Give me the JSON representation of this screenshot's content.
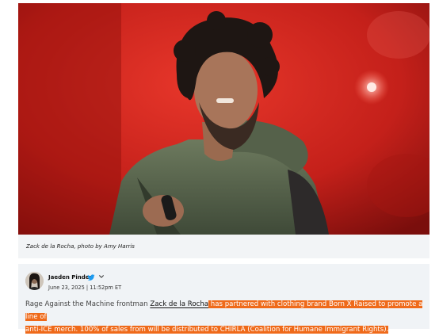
{
  "photo": {
    "alt": "Zack de la Rocha performing on stage",
    "caption": "Zack de la Rocha, photo by Amy Harris"
  },
  "post": {
    "author": "Jaeden Pinder",
    "timestamp": "June 23, 2025 | 11:52pm ET",
    "text_prefix": "Rage Against the Machine frontman ",
    "link_text": "Zack de la Rocha",
    "highlight_line1": " has partnered with clothing brand Born X Raised to promote a line of",
    "highlight_line2": "anti-ICE merch. 100% of sales from will be distributed to CHIRLA (Coalition for Humane Immigrant Rights).",
    "highlight_color": "#ef6a1a"
  },
  "icons": {
    "twitter": "twitter-bird-icon",
    "chevron": "chevron-down-icon"
  }
}
